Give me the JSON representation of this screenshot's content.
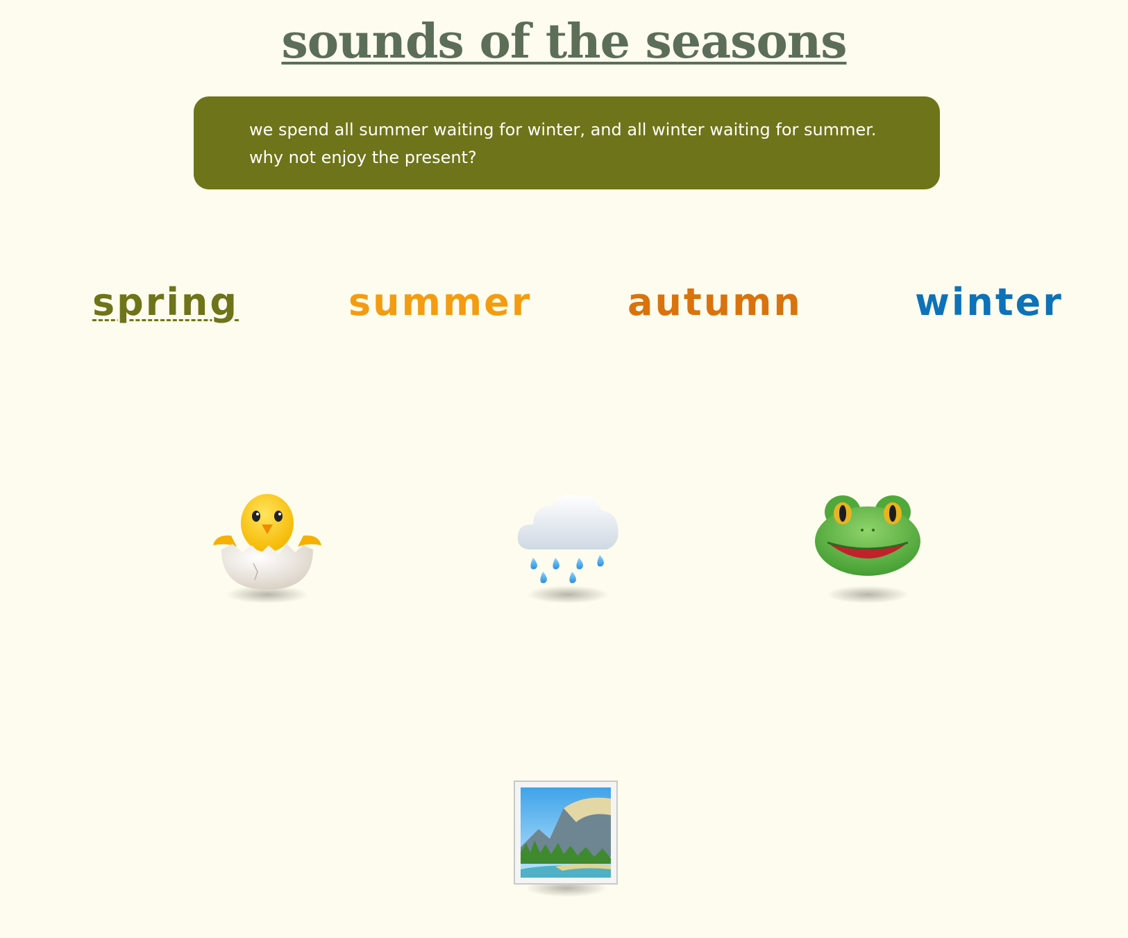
{
  "page": {
    "title": "sounds of the seasons",
    "quote_line1": "we spend all summer waiting for winter, and all winter waiting for summer.",
    "quote_line2": "why not enjoy the present?"
  },
  "seasons": [
    {
      "label": "spring",
      "color": "#6e7419",
      "active": true
    },
    {
      "label": "summer",
      "color": "#f39c12",
      "active": false
    },
    {
      "label": "autumn",
      "color": "#d9730d",
      "active": false
    },
    {
      "label": "winter",
      "color": "#0e72b8",
      "active": false
    }
  ],
  "sounds": [
    {
      "icon": "hatching-chick-icon"
    },
    {
      "icon": "rain-cloud-icon"
    },
    {
      "icon": "frog-icon"
    },
    {
      "icon": "landscape-picture-icon"
    }
  ],
  "colors": {
    "background": "#fefcee",
    "title": "#5c6e58",
    "quote_box": "#6e7419",
    "quote_text": "#ffffff"
  }
}
